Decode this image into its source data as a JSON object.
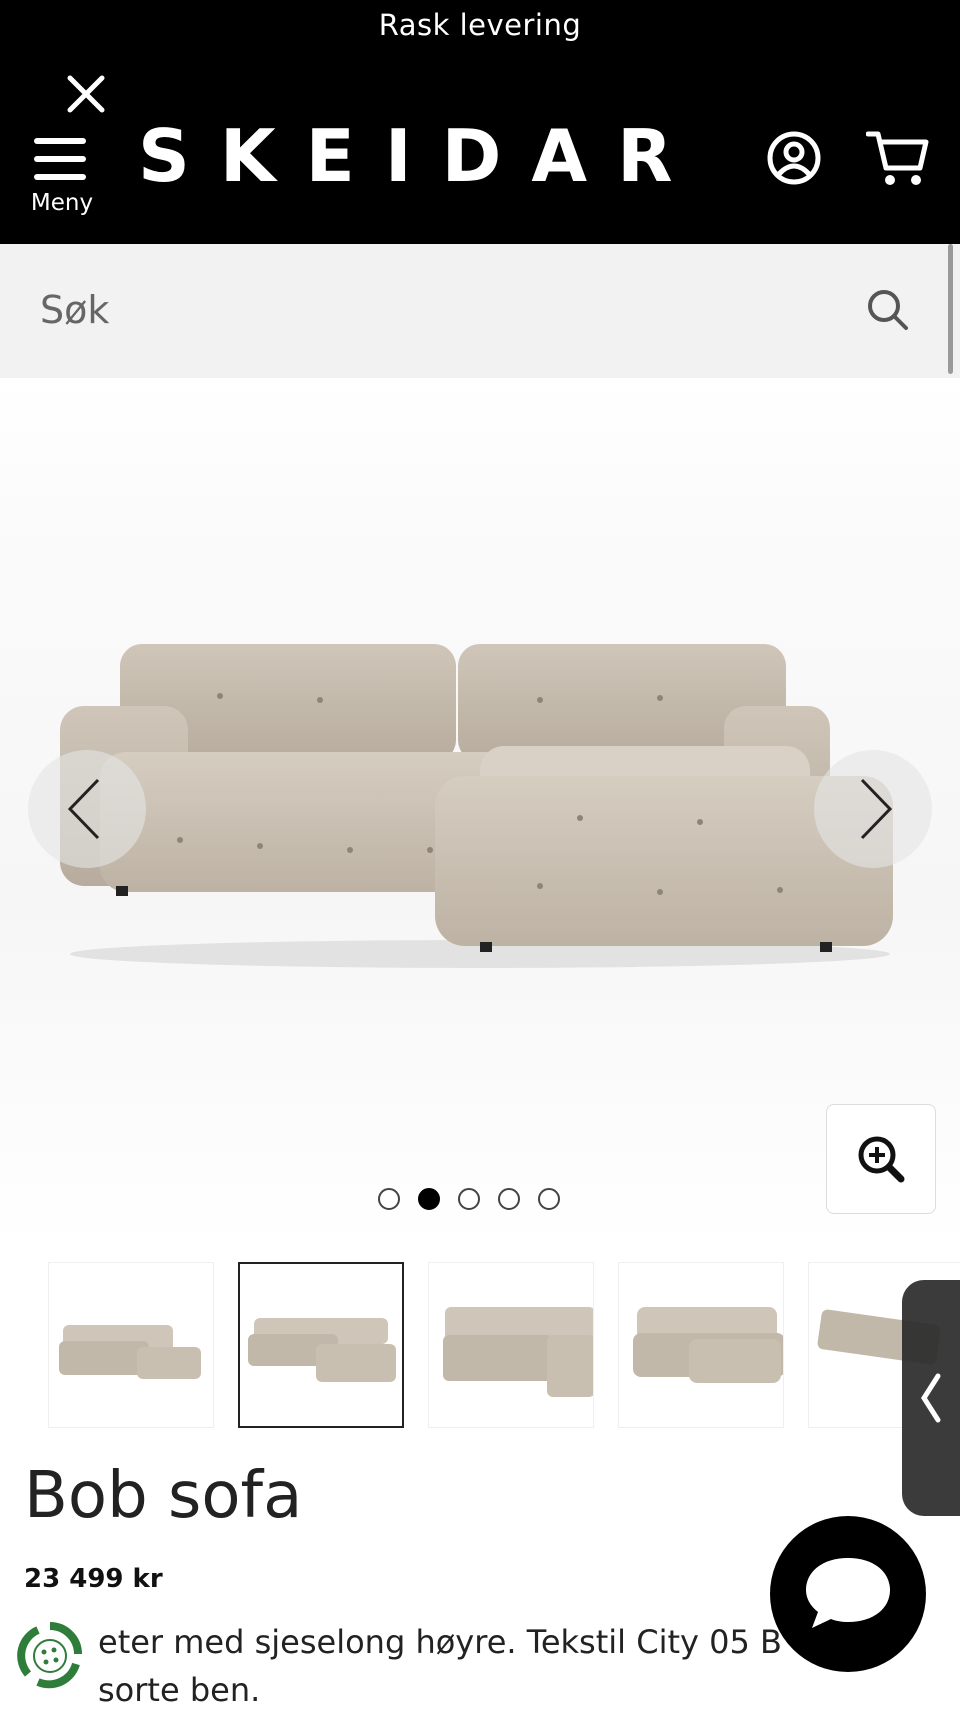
{
  "promo": {
    "text": "Rask levering"
  },
  "header": {
    "logo": "SKEIDAR",
    "menu_label": "Meny",
    "icons": {
      "close": "close-icon",
      "menu": "hamburger-icon",
      "account": "user-account-icon",
      "cart": "shopping-cart-icon"
    }
  },
  "search": {
    "placeholder": "Søk",
    "value": ""
  },
  "gallery": {
    "current_index": 1,
    "total": 5,
    "prev_icon": "chevron-left-icon",
    "next_icon": "chevron-right-icon",
    "zoom_icon": "zoom-in-icon",
    "thumbnails": [
      "thumbnail-1",
      "thumbnail-2",
      "thumbnail-3",
      "thumbnail-4",
      "thumbnail-5"
    ]
  },
  "product": {
    "title": "Bob sofa",
    "price": "23 499 kr",
    "description": "eter med sjeselong høyre. Tekstil City 05 B",
    "description_line2": "sorte ben."
  },
  "colors": {
    "header_bg": "#000000",
    "search_bg": "#f2f2f2",
    "sofa_fabric": "#c9bfb1",
    "eco_green": "#2f7d3a"
  }
}
